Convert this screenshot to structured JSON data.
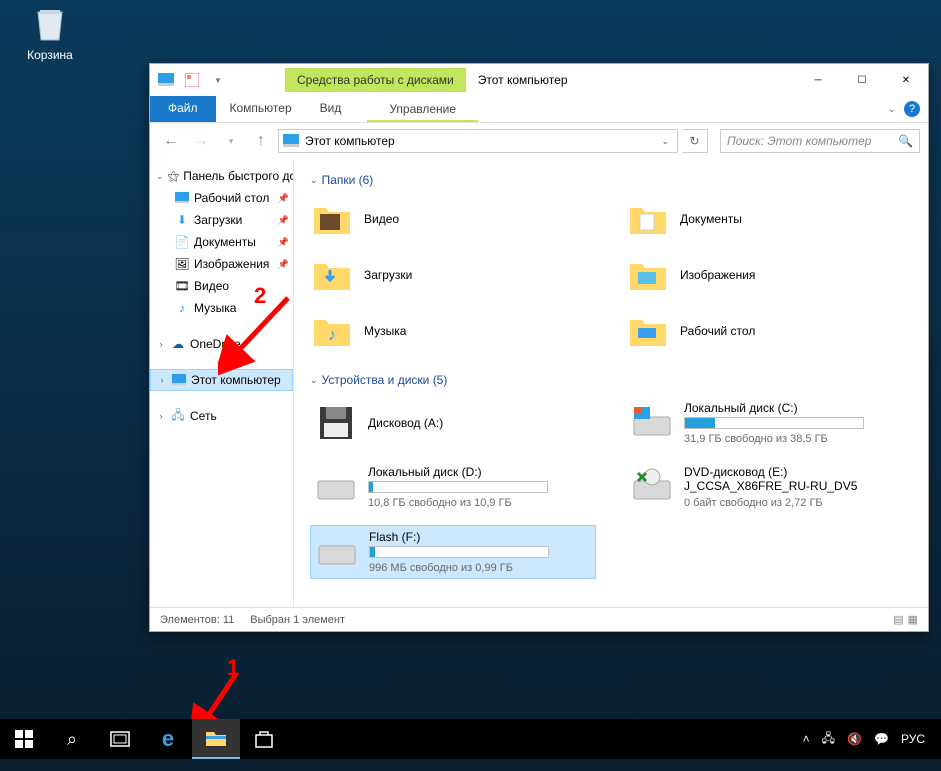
{
  "desktop": {
    "recycle_label": "Корзина"
  },
  "titlebar": {
    "ctx_tab": "Средства работы с дисками",
    "title": "Этот компьютер"
  },
  "ribbon": {
    "file": "Файл",
    "computer": "Компьютер",
    "view": "Вид",
    "manage": "Управление"
  },
  "address": {
    "location": "Этот компьютер"
  },
  "search": {
    "placeholder": "Поиск: Этот компьютер"
  },
  "sidebar": {
    "quick": "Панель быстрого до",
    "items": [
      {
        "label": "Рабочий стол"
      },
      {
        "label": "Загрузки"
      },
      {
        "label": "Документы"
      },
      {
        "label": "Изображения"
      },
      {
        "label": "Видео"
      },
      {
        "label": "Музыка"
      }
    ],
    "onedrive": "OneDrive",
    "thispc": "Этот компьютер",
    "network": "Сеть"
  },
  "groups": {
    "folders": "Папки (6)",
    "devices": "Устройства и диски (5)"
  },
  "folders": [
    {
      "label": "Видео"
    },
    {
      "label": "Документы"
    },
    {
      "label": "Загрузки"
    },
    {
      "label": "Изображения"
    },
    {
      "label": "Музыка"
    },
    {
      "label": "Рабочий стол"
    }
  ],
  "devices": {
    "floppy": {
      "label": "Дисковод (A:)"
    },
    "c": {
      "label": "Локальный диск (C:)",
      "sub": "31,9 ГБ свободно из 38,5 ГБ",
      "fill": 17
    },
    "d": {
      "label": "Локальный диск (D:)",
      "sub": "10,8 ГБ свободно из 10,9 ГБ",
      "fill": 2
    },
    "dvd": {
      "label": "DVD-дисковод (E:)",
      "label2": "J_CCSA_X86FRE_RU-RU_DV5",
      "sub": "0 байт свободно из 2,72 ГБ"
    },
    "flash": {
      "label": "Flash (F:)",
      "sub": "996 МБ свободно из 0,99 ГБ",
      "fill": 3
    }
  },
  "status": {
    "elements": "Элементов: 11",
    "selected": "Выбран 1 элемент"
  },
  "tray": {
    "lang": "РУС"
  },
  "annotations": {
    "one": "1",
    "two": "2"
  }
}
